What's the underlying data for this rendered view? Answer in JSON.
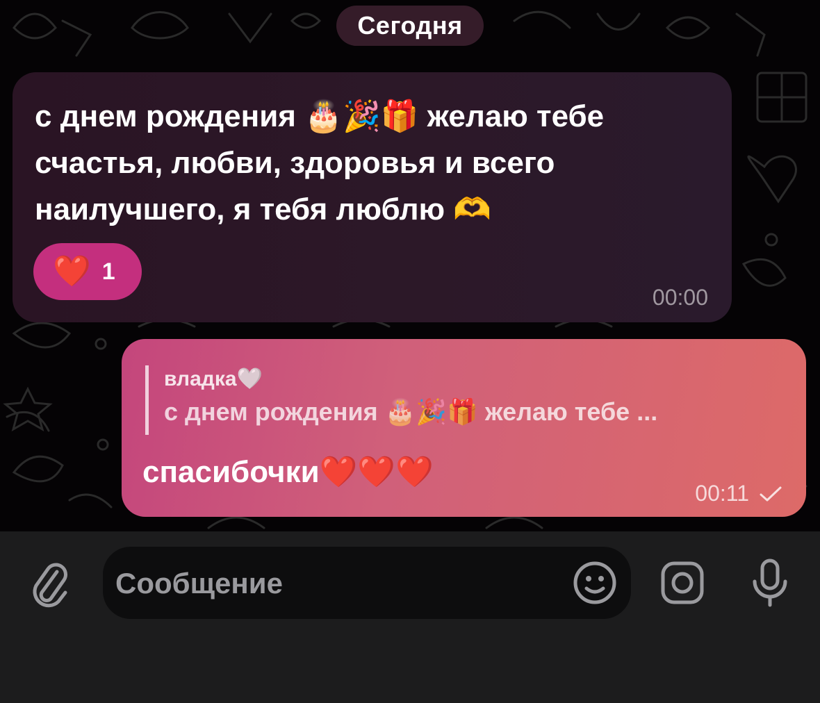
{
  "chat": {
    "date_label": "Сегодня",
    "incoming": {
      "text": "с днем рождения 🎂🎉🎁 желаю тебе\nсчастья, любви, здоровья и всего\nнаилучшего, я тебя люблю 🫶",
      "reaction": {
        "emoji": "❤️",
        "count": "1"
      },
      "time": "00:00"
    },
    "outgoing": {
      "reply_author": "владка🤍",
      "reply_text": "с днем рождения 🎂🎉🎁 желаю тебе ...",
      "text": "спасибочки❤️❤️❤️",
      "time": "00:11",
      "status_icon": "check-icon"
    }
  },
  "composer": {
    "placeholder": "Сообщение",
    "icons": [
      "paperclip-icon",
      "sticker-icon",
      "camera-icon",
      "microphone-icon"
    ]
  },
  "colors": {
    "reaction_bg": "#c42f7e",
    "outgoing_gradient_start": "#c4467c",
    "outgoing_gradient_end": "#dd6a68",
    "incoming_bg": "#2c1828"
  }
}
